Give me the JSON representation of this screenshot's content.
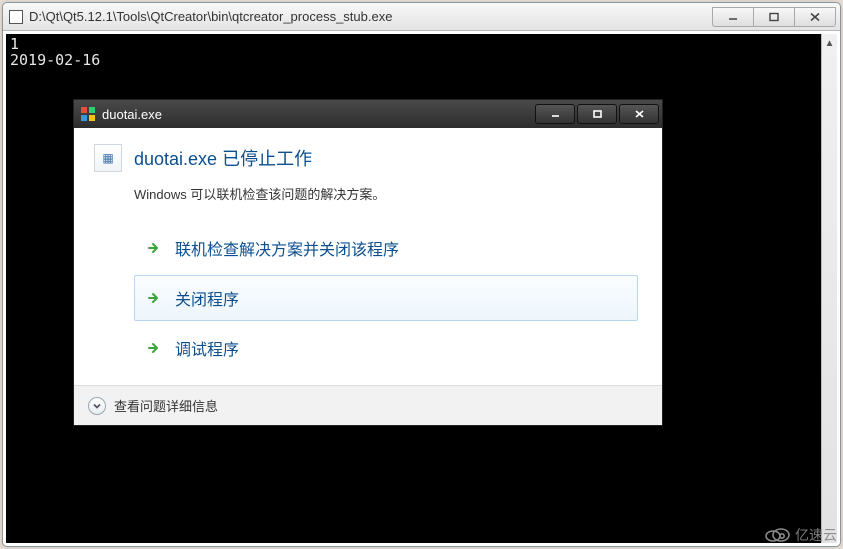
{
  "console": {
    "title": "D:\\Qt\\Qt5.12.1\\Tools\\QtCreator\\bin\\qtcreator_process_stub.exe",
    "lines": [
      "1",
      "2019-02-16"
    ]
  },
  "dialog": {
    "title": "duotai.exe",
    "heading": "duotai.exe 已停止工作",
    "subtitle": "Windows 可以联机检查该问题的解决方案。",
    "options": [
      "联机检查解决方案并关闭该程序",
      "关闭程序",
      "调试程序"
    ],
    "footer": "查看问题详细信息"
  },
  "watermark": "亿速云"
}
